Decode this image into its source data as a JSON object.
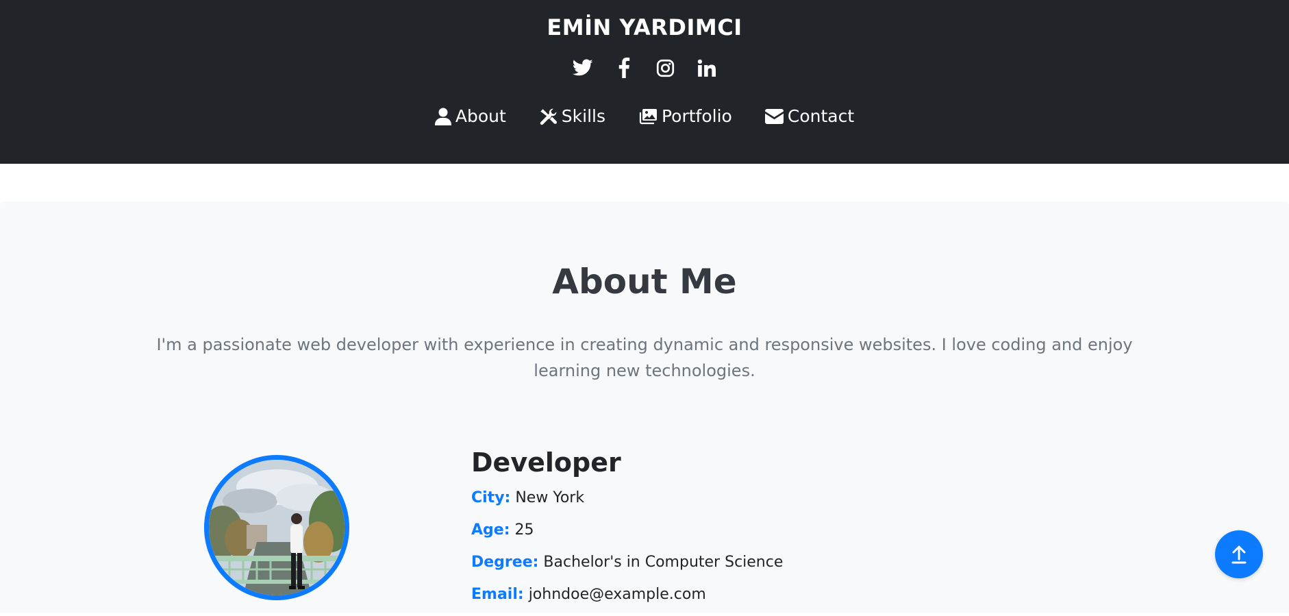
{
  "header": {
    "site_title": "EMİN YARDIMCI",
    "background_color": "#212529",
    "social_icons": [
      "twitter-icon",
      "facebook-icon",
      "instagram-icon",
      "linkedin-icon"
    ],
    "nav": [
      {
        "label": "About",
        "icon": "user-icon"
      },
      {
        "label": "Skills",
        "icon": "tools-icon"
      },
      {
        "label": "Portfolio",
        "icon": "images-icon"
      },
      {
        "label": "Contact",
        "icon": "envelope-icon"
      }
    ]
  },
  "about": {
    "title": "About Me",
    "lead": "I'm a passionate web developer with experience in creating dynamic and responsive websites. I love coding and enjoy learning new technologies.",
    "role": "Developer",
    "details": [
      {
        "label": "City:",
        "value": "New York"
      },
      {
        "label": "Age:",
        "value": "25"
      },
      {
        "label": "Degree:",
        "value": "Bachelor's in Computer Science"
      },
      {
        "label": "Email:",
        "value": "johndoe@example.com"
      }
    ],
    "accent_color": "#0d7bff",
    "section_background": "#f8f9fa"
  },
  "back_to_top": {
    "icon": "arrow-up-icon",
    "color": "#0d7bff"
  }
}
